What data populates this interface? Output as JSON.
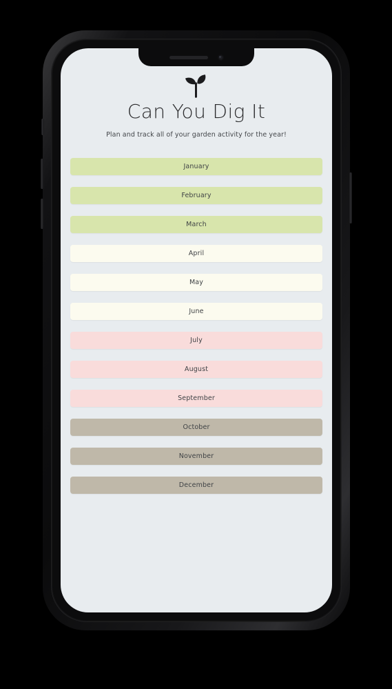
{
  "device": {
    "type": "smartphone-mockup",
    "notch": {
      "speaker": "earpiece-speaker",
      "camera": "front-camera"
    },
    "buttons": [
      {
        "name": "silent-switch"
      },
      {
        "name": "volume-up"
      },
      {
        "name": "volume-down"
      },
      {
        "name": "power-button"
      }
    ]
  },
  "app": {
    "logo_icon": "sprout-icon",
    "title": "Can You Dig It",
    "subtitle": "Plan and track all of your garden activity for the year!",
    "screen_background": "#e8ecef",
    "title_color": "#2b2b2d",
    "subtitle_color": "#43464a",
    "button_text_color": "#3f4245"
  },
  "months": [
    {
      "label": "January",
      "color": "#d8e5ac"
    },
    {
      "label": "February",
      "color": "#d8e5ac"
    },
    {
      "label": "March",
      "color": "#d8e5ac"
    },
    {
      "label": "April",
      "color": "#fcfbef"
    },
    {
      "label": "May",
      "color": "#fcfbef"
    },
    {
      "label": "June",
      "color": "#fcfbef"
    },
    {
      "label": "July",
      "color": "#f9dcdb"
    },
    {
      "label": "August",
      "color": "#f9dcdb"
    },
    {
      "label": "September",
      "color": "#f9dcdb"
    },
    {
      "label": "October",
      "color": "#bfb8a9"
    },
    {
      "label": "November",
      "color": "#bfb8a9"
    },
    {
      "label": "December",
      "color": "#bfb8a9"
    }
  ]
}
